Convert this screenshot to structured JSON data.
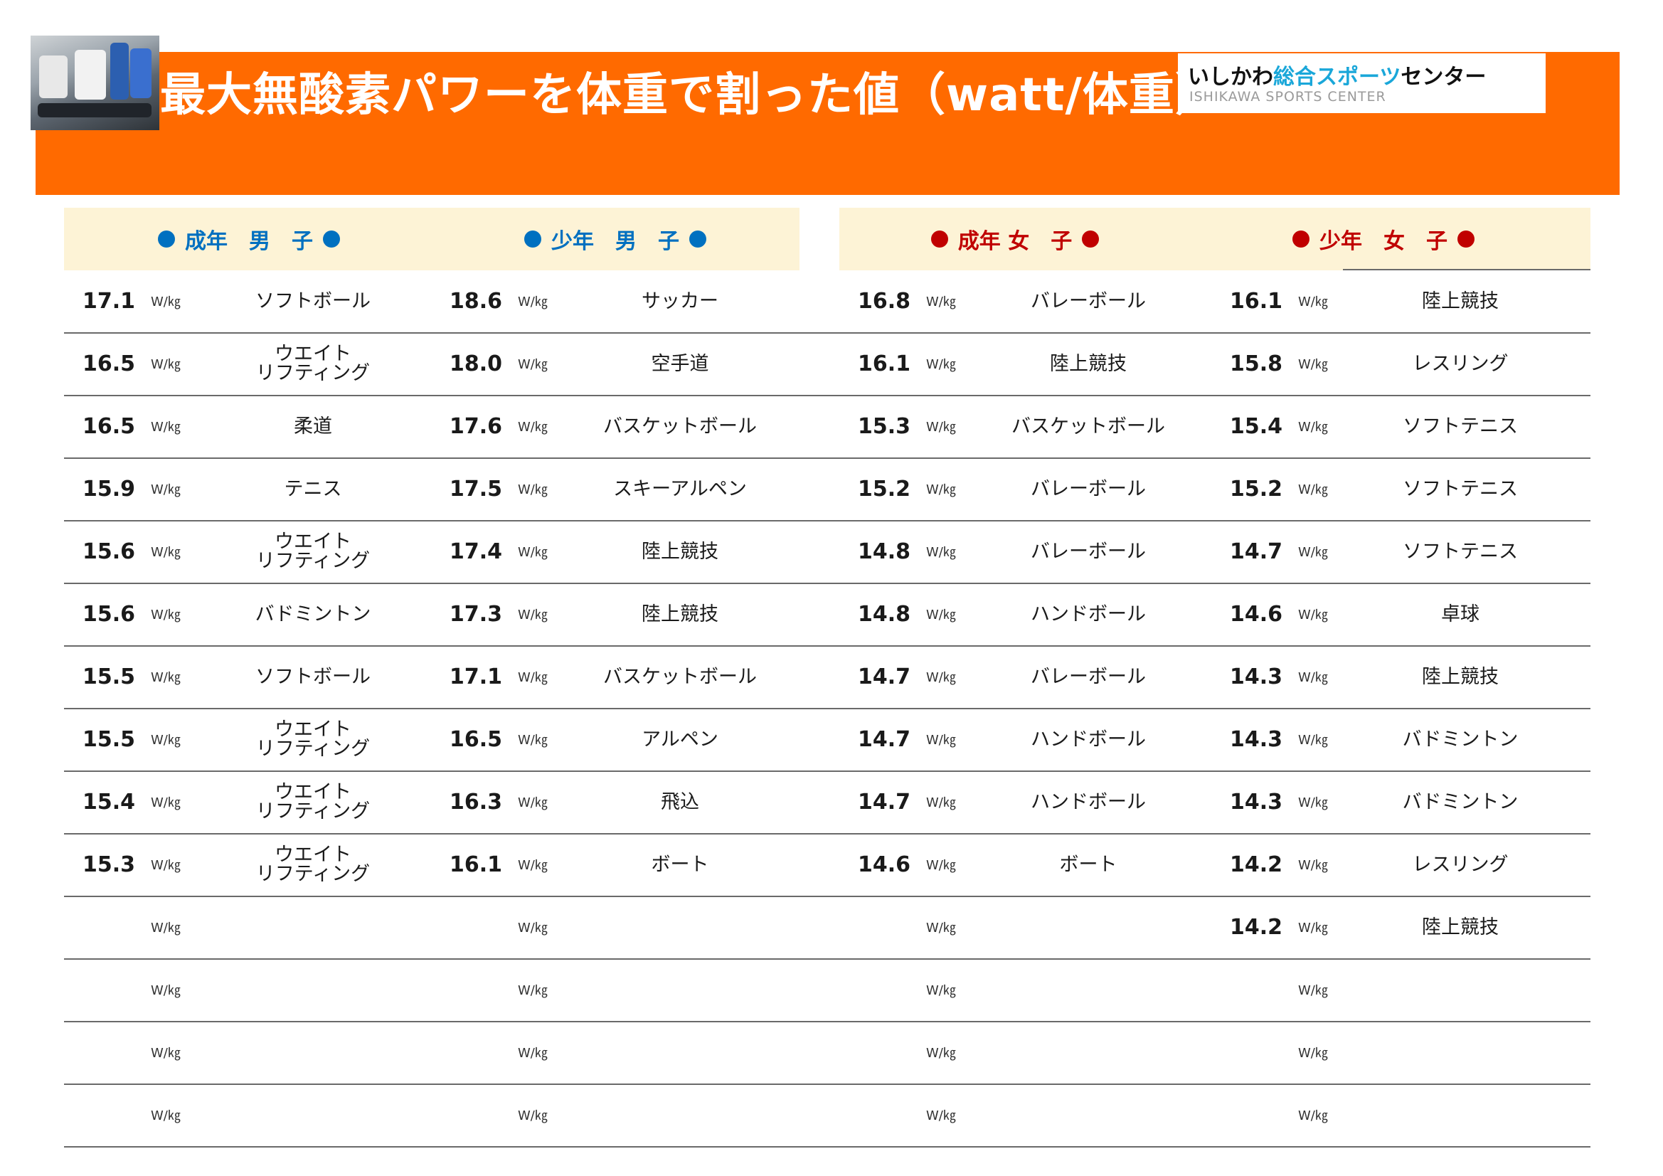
{
  "banner": {
    "title": "最大無酸素パワーを体重で割った値（watt/体重）",
    "color": "#ff6a00",
    "photo_icon": "training-photo-icon"
  },
  "logo": {
    "main_a": "いしかわ",
    "main_b": "総合スポーツ",
    "main_c": "センター",
    "sub": "ISHIKAWA SPORTS CENTER",
    "accent_color": "#1aa7d9"
  },
  "categories": [
    {
      "label": "成年　男　子",
      "color": "#0070c0"
    },
    {
      "label": "少年　男　子",
      "color": "#0070c0"
    },
    {
      "label": "成年  女　子",
      "color": "#c00000"
    },
    {
      "label": "少年　女　子",
      "color": "#c00000"
    }
  ],
  "unit": "W/㎏",
  "columns": [
    {
      "rows": [
        {
          "value": "17.1",
          "sport": "ソフトボール"
        },
        {
          "value": "16.5",
          "sport": "ウエイト\nリフティング"
        },
        {
          "value": "16.5",
          "sport": "柔道"
        },
        {
          "value": "15.9",
          "sport": "テニス"
        },
        {
          "value": "15.6",
          "sport": "ウエイト\nリフティング"
        },
        {
          "value": "15.6",
          "sport": "バドミントン"
        },
        {
          "value": "15.5",
          "sport": "ソフトボール"
        },
        {
          "value": "15.5",
          "sport": "ウエイト\nリフティング"
        },
        {
          "value": "15.4",
          "sport": "ウエイト\nリフティング"
        },
        {
          "value": "15.3",
          "sport": "ウエイト\nリフティング"
        },
        {
          "value": "",
          "sport": ""
        },
        {
          "value": "",
          "sport": ""
        },
        {
          "value": "",
          "sport": ""
        },
        {
          "value": "",
          "sport": ""
        }
      ]
    },
    {
      "rows": [
        {
          "value": "18.6",
          "sport": "サッカー"
        },
        {
          "value": "18.0",
          "sport": "空手道"
        },
        {
          "value": "17.6",
          "sport": "バスケットボール"
        },
        {
          "value": "17.5",
          "sport": "スキーアルペン"
        },
        {
          "value": "17.4",
          "sport": "陸上競技"
        },
        {
          "value": "17.3",
          "sport": "陸上競技"
        },
        {
          "value": "17.1",
          "sport": "バスケットボール"
        },
        {
          "value": "16.5",
          "sport": "アルペン"
        },
        {
          "value": "16.3",
          "sport": "飛込"
        },
        {
          "value": "16.1",
          "sport": "ボート"
        },
        {
          "value": "",
          "sport": ""
        },
        {
          "value": "",
          "sport": ""
        },
        {
          "value": "",
          "sport": ""
        },
        {
          "value": "",
          "sport": ""
        }
      ]
    },
    {
      "rows": [
        {
          "value": "16.8",
          "sport": "バレーボール"
        },
        {
          "value": "16.1",
          "sport": "陸上競技"
        },
        {
          "value": "15.3",
          "sport": "バスケットボール"
        },
        {
          "value": "15.2",
          "sport": "バレーボール"
        },
        {
          "value": "14.8",
          "sport": "バレーボール"
        },
        {
          "value": "14.8",
          "sport": "ハンドボール"
        },
        {
          "value": "14.7",
          "sport": "バレーボール"
        },
        {
          "value": "14.7",
          "sport": "ハンドボール"
        },
        {
          "value": "14.7",
          "sport": "ハンドボール"
        },
        {
          "value": "14.6",
          "sport": "ボート"
        },
        {
          "value": "",
          "sport": ""
        },
        {
          "value": "",
          "sport": ""
        },
        {
          "value": "",
          "sport": ""
        },
        {
          "value": "",
          "sport": ""
        }
      ]
    },
    {
      "rows": [
        {
          "value": "16.1",
          "sport": "陸上競技"
        },
        {
          "value": "15.8",
          "sport": "レスリング"
        },
        {
          "value": "15.4",
          "sport": "ソフトテニス"
        },
        {
          "value": "15.2",
          "sport": "ソフトテニス"
        },
        {
          "value": "14.7",
          "sport": "ソフトテニス"
        },
        {
          "value": "14.6",
          "sport": "卓球"
        },
        {
          "value": "14.3",
          "sport": "陸上競技"
        },
        {
          "value": "14.3",
          "sport": "バドミントン"
        },
        {
          "value": "14.3",
          "sport": "バドミントン"
        },
        {
          "value": "14.2",
          "sport": "レスリング"
        },
        {
          "value": "14.2",
          "sport": "陸上競技"
        },
        {
          "value": "",
          "sport": ""
        },
        {
          "value": "",
          "sport": ""
        },
        {
          "value": "",
          "sport": ""
        }
      ]
    }
  ]
}
